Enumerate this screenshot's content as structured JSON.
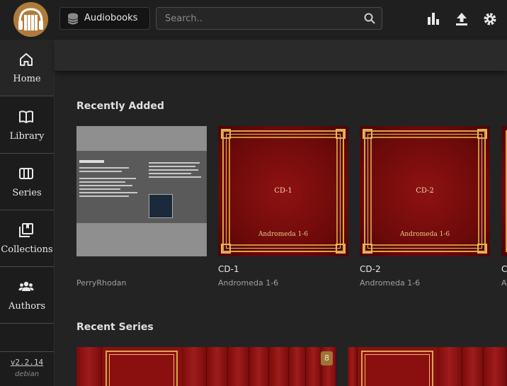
{
  "header": {
    "library_name": "Audiobooks",
    "search_placeholder": "Search.."
  },
  "sidebar": {
    "items": [
      {
        "label": "Home",
        "icon": "home-icon"
      },
      {
        "label": "Library",
        "icon": "book-icon"
      },
      {
        "label": "Series",
        "icon": "columns-icon"
      },
      {
        "label": "Collections",
        "icon": "collections-icon"
      },
      {
        "label": "Authors",
        "icon": "people-icon"
      }
    ],
    "active": "Home",
    "version": "v2.2.14",
    "os": "debian"
  },
  "recently_added": {
    "title": "Recently Added",
    "books": [
      {
        "title": "",
        "subtitle": "PerryRhodan",
        "cover": "gray"
      },
      {
        "title": "CD-1",
        "subtitle": "Andromeda 1-6",
        "cover": "red",
        "cover_title": "CD-1",
        "cover_subtitle": "Andromeda 1-6"
      },
      {
        "title": "CD-2",
        "subtitle": "Andromeda 1-6",
        "cover": "red",
        "cover_title": "CD-2",
        "cover_subtitle": "Andromeda 1-6"
      },
      {
        "title": "C",
        "subtitle": "A",
        "cover": "red"
      }
    ]
  },
  "recent_series": {
    "title": "Recent Series",
    "badge_count": "8"
  },
  "colors": {
    "accent": "#b07b3a",
    "cover_red": "#8e1212",
    "gold": "#d9a74a"
  }
}
